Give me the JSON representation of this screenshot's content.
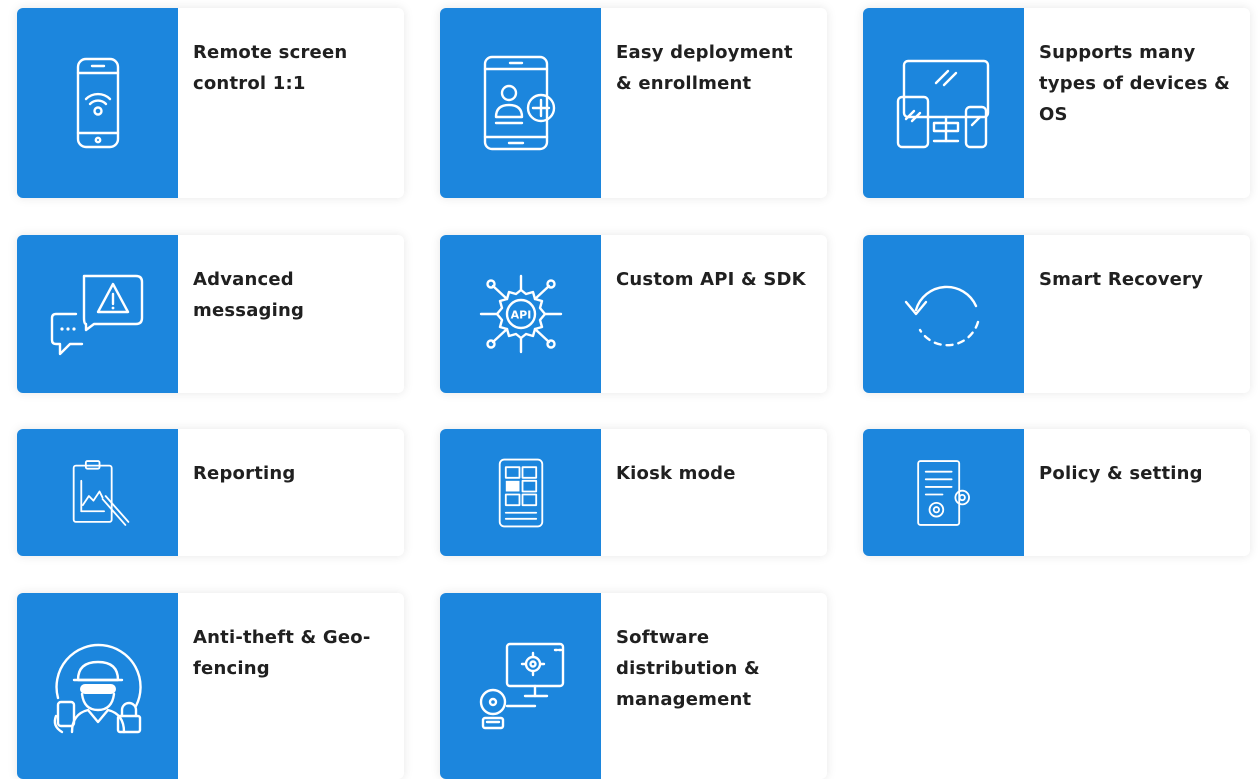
{
  "features": [
    {
      "label": "Remote screen control 1:1",
      "icon": "smartphone-wifi-icon"
    },
    {
      "label": "Easy deployment & enrollment",
      "icon": "tablet-add-user-icon"
    },
    {
      "label": "Supports many types of devices & OS",
      "icon": "multi-device-icon"
    },
    {
      "label": "Advanced messaging",
      "icon": "warning-message-icon"
    },
    {
      "label": "Custom API & SDK",
      "icon": "api-gear-icon"
    },
    {
      "label": "Smart Recovery",
      "icon": "recovery-cycle-icon"
    },
    {
      "label": "Reporting",
      "icon": "report-chart-icon"
    },
    {
      "label": "Kiosk mode",
      "icon": "kiosk-grid-icon"
    },
    {
      "label": "Policy & setting",
      "icon": "policy-document-icon"
    },
    {
      "label": "Anti-theft & Geo-fencing",
      "icon": "thief-lock-icon"
    },
    {
      "label": "Software distribution & management",
      "icon": "software-monitor-icon"
    }
  ],
  "colors": {
    "accent": "#1c86dd",
    "text": "#202020",
    "card_background": "#ffffff"
  }
}
